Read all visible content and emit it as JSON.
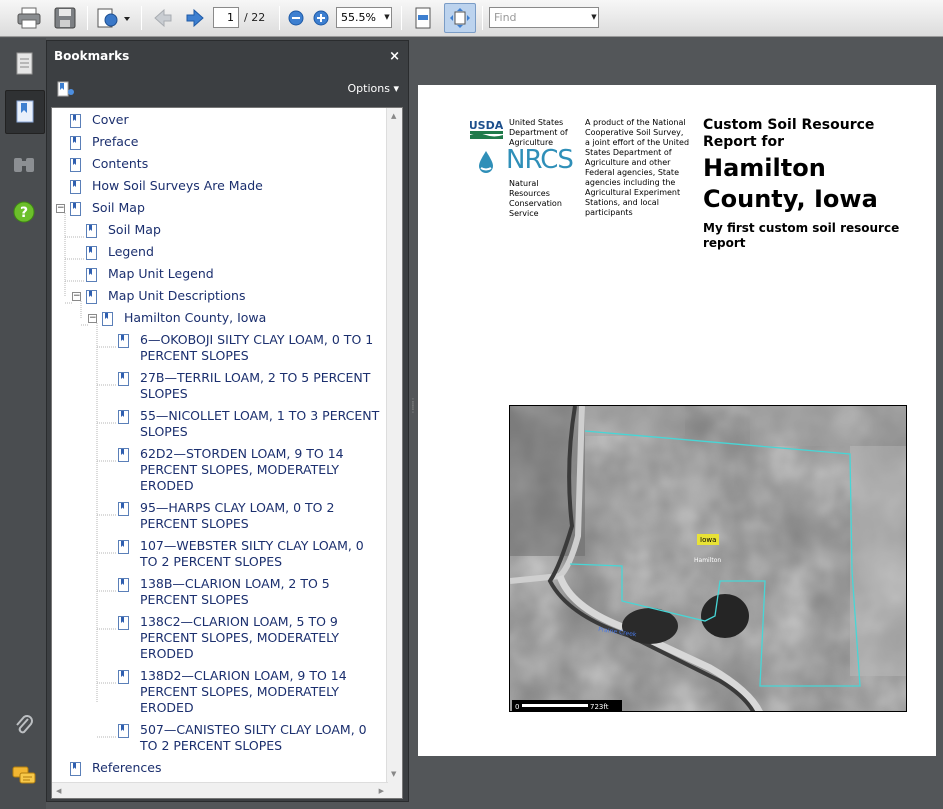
{
  "toolbar": {
    "current_page": "1",
    "page_total": "/ 22",
    "zoom": "55.5%",
    "find_placeholder": "Find"
  },
  "bookmarks": {
    "title": "Bookmarks",
    "close": "×",
    "options": "Options",
    "items": [
      {
        "lines": [
          "Cover"
        ]
      },
      {
        "lines": [
          "Preface"
        ]
      },
      {
        "lines": [
          "Contents"
        ]
      },
      {
        "lines": [
          "How Soil Surveys Are Made"
        ]
      },
      {
        "lines": [
          "Soil Map"
        ]
      },
      {
        "lines": [
          "Soil Map"
        ]
      },
      {
        "lines": [
          "Legend"
        ]
      },
      {
        "lines": [
          "Map Unit Legend"
        ]
      },
      {
        "lines": [
          "Map Unit Descriptions"
        ]
      },
      {
        "lines": [
          "Hamilton County, Iowa"
        ]
      },
      {
        "lines": [
          "6—OKOBOJI SILTY CLAY LOAM, 0 TO 1",
          "PERCENT SLOPES"
        ]
      },
      {
        "lines": [
          "27B—TERRIL LOAM, 2 TO 5 PERCENT",
          "SLOPES"
        ]
      },
      {
        "lines": [
          "55—NICOLLET LOAM, 1 TO 3 PERCENT",
          "SLOPES"
        ]
      },
      {
        "lines": [
          "62D2—STORDEN LOAM, 9 TO 14",
          "PERCENT SLOPES, MODERATELY",
          "ERODED"
        ]
      },
      {
        "lines": [
          "95—HARPS CLAY LOAM, 0 TO 2",
          "PERCENT SLOPES"
        ]
      },
      {
        "lines": [
          "107—WEBSTER SILTY CLAY LOAM, 0",
          "TO 2 PERCENT SLOPES"
        ]
      },
      {
        "lines": [
          "138B—CLARION LOAM, 2 TO 5",
          "PERCENT SLOPES"
        ]
      },
      {
        "lines": [
          "138C2—CLARION LOAM, 5 TO 9",
          "PERCENT SLOPES, MODERATELY",
          "ERODED"
        ]
      },
      {
        "lines": [
          "138D2—CLARION LOAM, 9 TO 14",
          "PERCENT SLOPES, MODERATELY",
          "ERODED"
        ]
      },
      {
        "lines": [
          "507—CANISTEO SILTY CLAY LOAM, 0",
          "TO 2 PERCENT SLOPES"
        ]
      },
      {
        "lines": [
          "References"
        ]
      }
    ]
  },
  "document": {
    "usda_logo": "USDA",
    "nrcs_logo": "NRCS",
    "agency_lines": [
      "United States",
      "Department of",
      "Agriculture"
    ],
    "nrcs_lines": [
      "Natural",
      "Resources",
      "Conservation",
      "Service"
    ],
    "product_lines": [
      "A product of the National",
      "Cooperative Soil Survey,",
      "a joint effort of the United",
      "States Department of",
      "Agriculture and other",
      "Federal agencies, State",
      "agencies including the",
      "Agricultural Experiment",
      "Stations, and local",
      "participants"
    ],
    "title_small_lines": [
      "Custom Soil Resource",
      "Report for"
    ],
    "title_big_lines": [
      "Hamilton",
      "County, Iowa"
    ],
    "subtitle_lines": [
      "My first custom soil resource",
      "report"
    ],
    "map": {
      "label_state": "Iowa",
      "label_place": "Hamilton",
      "label_creek": "Prairie Creek",
      "scale_start": "0",
      "scale_end": "723ft"
    }
  },
  "colors": {
    "toolbar_bg": "#dcdcdc",
    "panel_bg": "#3c3f42",
    "bookmark_text": "#1b2f6e",
    "boundary": "#47d6d6"
  }
}
